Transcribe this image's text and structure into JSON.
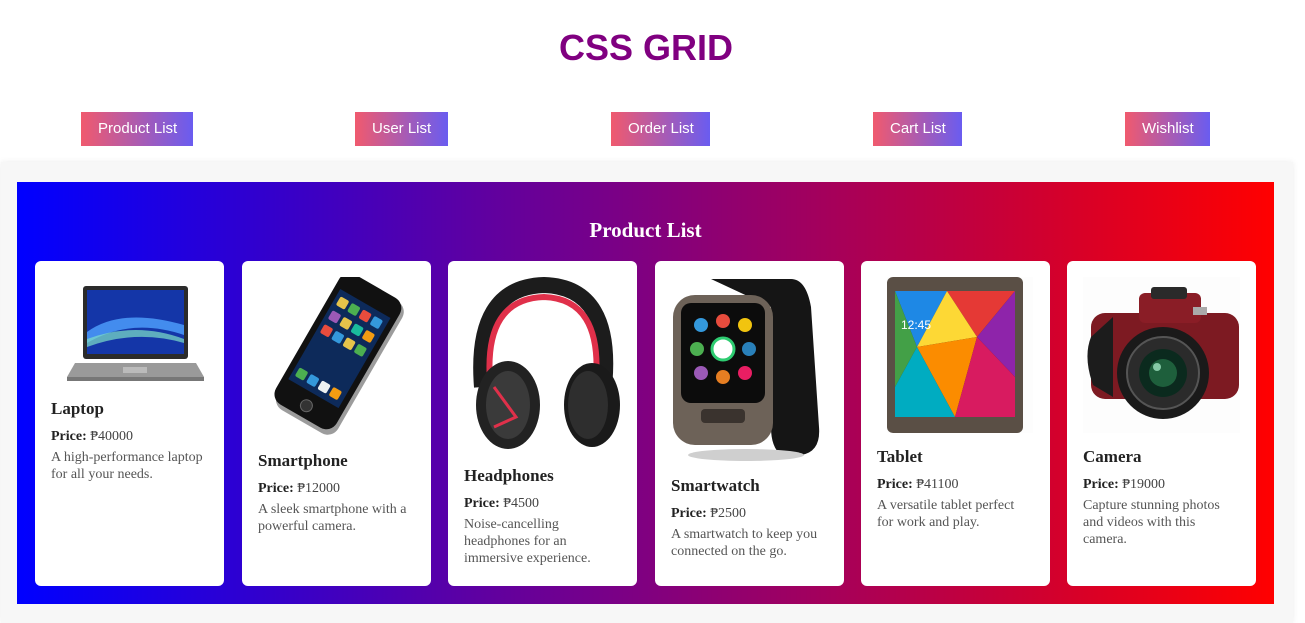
{
  "page": {
    "title": "CSS GRID"
  },
  "nav": {
    "items": [
      {
        "label": "Product List"
      },
      {
        "label": "User List"
      },
      {
        "label": "Order List"
      },
      {
        "label": "Cart List"
      },
      {
        "label": "Wishlist"
      }
    ]
  },
  "section": {
    "title": "Product List"
  },
  "price_label": "Price:",
  "products": [
    {
      "name": "Laptop",
      "price": "₱40000",
      "description": "A high-performance laptop for all your needs.",
      "image": "laptop-image"
    },
    {
      "name": "Smartphone",
      "price": "₱12000",
      "description": "A sleek smartphone with a powerful camera.",
      "image": "smartphone-image"
    },
    {
      "name": "Headphones",
      "price": "₱4500",
      "description": "Noise-cancelling headphones for an immersive experience.",
      "image": "headphones-image"
    },
    {
      "name": "Smartwatch",
      "price": "₱2500",
      "description": "A smartwatch to keep you connected on the go.",
      "image": "smartwatch-image"
    },
    {
      "name": "Tablet",
      "price": "₱41100",
      "description": "A versatile tablet perfect for work and play.",
      "image": "tablet-image"
    },
    {
      "name": "Camera",
      "price": "₱19000",
      "description": "Capture stunning photos and videos with this camera.",
      "image": "camera-image"
    }
  ],
  "colors": {
    "title": "#800080",
    "button_gradient_start": "#f05a6e",
    "button_gradient_end": "#6a5cf0",
    "section_gradient": [
      "#0000ff",
      "#800080",
      "#ff0000"
    ]
  }
}
